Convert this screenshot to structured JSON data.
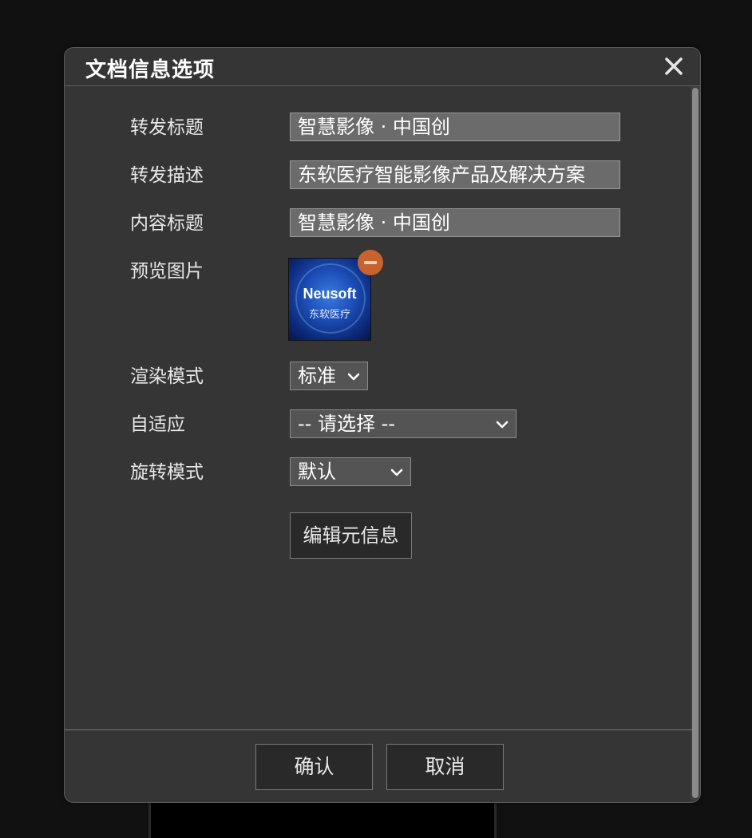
{
  "dialog": {
    "title": "文档信息选项",
    "close_icon": "close-icon"
  },
  "form": {
    "share_title": {
      "label": "转发标题",
      "value": "智慧影像 · 中国创"
    },
    "share_description": {
      "label": "转发描述",
      "value": "东软医疗智能影像产品及解决方案"
    },
    "content_title": {
      "label": "内容标题",
      "value": "智慧影像 · 中国创"
    },
    "preview_image": {
      "label": "预览图片",
      "brand_text": "Neusoft",
      "brand_subtext": "东软医疗",
      "remove_icon": "minus-circle-icon"
    },
    "render_mode": {
      "label": "渲染模式",
      "selected": "标准"
    },
    "adaptive": {
      "label": "自适应",
      "selected": "-- 请选择 --"
    },
    "rotation_mode": {
      "label": "旋转模式",
      "selected": "默认"
    },
    "edit_metadata_label": "编辑元信息"
  },
  "footer": {
    "confirm_label": "确认",
    "cancel_label": "取消"
  },
  "colors": {
    "dialog_bg": "#353535",
    "input_bg": "#6b6b6b",
    "select_bg": "#545454",
    "remove_badge": "#c8622e",
    "button_bg": "#292929"
  }
}
